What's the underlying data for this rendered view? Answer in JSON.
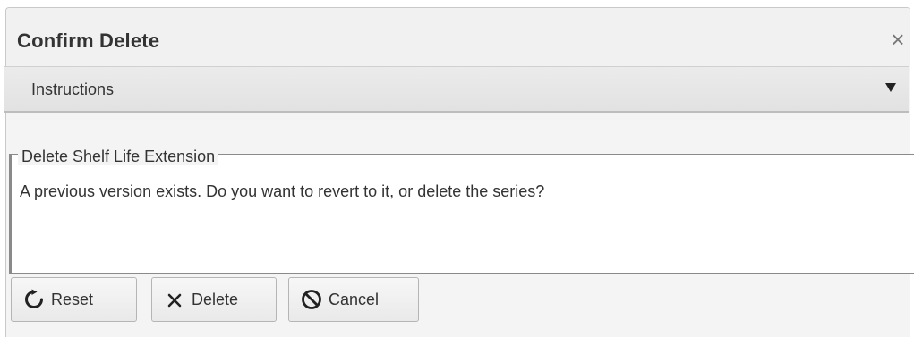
{
  "dialog": {
    "title": "Confirm Delete",
    "close_glyph": "×"
  },
  "instructions": {
    "label": "Instructions",
    "expander_icon": "caret-down-icon"
  },
  "group": {
    "legend": "Delete Shelf Life Extension",
    "message": "A previous version exists. Do you want to revert to it, or delete the series?"
  },
  "buttons": {
    "reset": {
      "label": "Reset",
      "icon": "refresh-icon"
    },
    "delete": {
      "label": "Delete",
      "icon": "x-icon"
    },
    "cancel": {
      "label": "Cancel",
      "icon": "ban-icon"
    }
  }
}
